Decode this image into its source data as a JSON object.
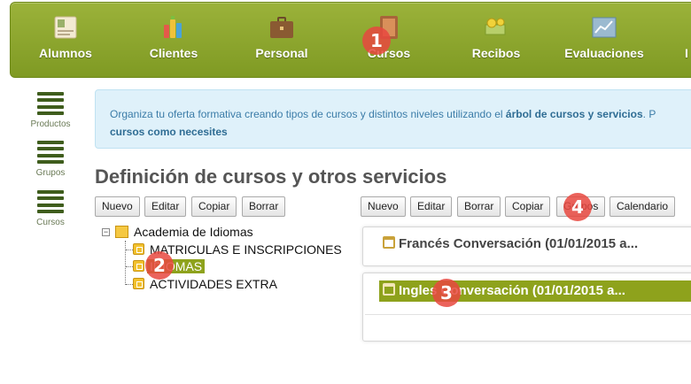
{
  "nav": {
    "items": [
      {
        "label": "Alumnos",
        "icon": "student-card-icon"
      },
      {
        "label": "Clientes",
        "icon": "bottles-icon"
      },
      {
        "label": "Personal",
        "icon": "briefcase-icon"
      },
      {
        "label": "Cursos",
        "icon": "book-icon"
      },
      {
        "label": "Recibos",
        "icon": "money-icon"
      },
      {
        "label": "Evaluaciones",
        "icon": "chart-icon"
      },
      {
        "label": "I",
        "icon": ""
      }
    ]
  },
  "sidebar": {
    "items": [
      {
        "label": "Productos",
        "icon": "list-icon"
      },
      {
        "label": "Grupos",
        "icon": "list-icon"
      },
      {
        "label": "Cursos",
        "icon": "list-icon"
      }
    ]
  },
  "info": {
    "text_before": "Organiza tu oferta formativa creando tipos de cursos y distintos niveles utilizando el ",
    "bold1": "árbol de cursos y servicios",
    "text_after": ". P",
    "bold2": "cursos como necesites"
  },
  "page_title": "Definición de cursos y otros servicios",
  "left_toolbar": {
    "nuevo": "Nuevo",
    "editar": "Editar",
    "copiar": "Copiar",
    "borrar": "Borrar"
  },
  "right_toolbar": {
    "nuevo": "Nuevo",
    "editar": "Editar",
    "borrar": "Borrar",
    "copiar": "Copiar",
    "grupos": "Grupos",
    "calendario": "Calendario"
  },
  "tree": {
    "toggle": "−",
    "root": "Academia de Idiomas",
    "children": [
      {
        "label": "MATRICULAS E INSCRIPCIONES",
        "selected": false
      },
      {
        "label": "IDIOMAS",
        "selected": true
      },
      {
        "label": "ACTIVIDADES EXTRA",
        "selected": false
      }
    ]
  },
  "groups": [
    {
      "title": "Francés Conversación (01/01/2015 a...",
      "selected": false
    },
    {
      "title": "Ingles Conversación (01/01/2015 a...",
      "selected": true
    }
  ],
  "markers": [
    "1",
    "2",
    "3",
    "4"
  ],
  "colors": {
    "nav_green": "#8ea21c",
    "selection_green": "#8ea21c",
    "marker_red": "#e84840",
    "info_bg": "#dff1fa"
  }
}
